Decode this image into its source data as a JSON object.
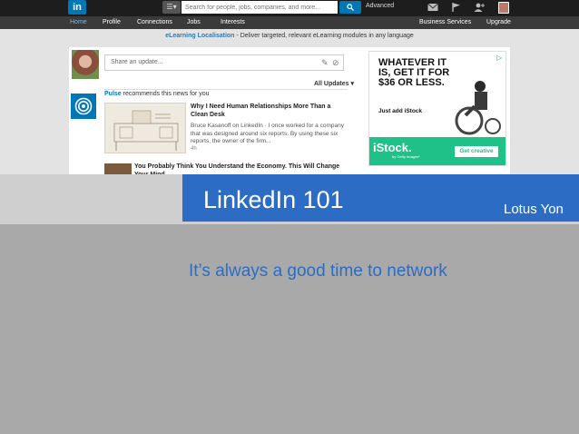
{
  "linkedin": {
    "search_placeholder": "Search for people, jobs, companies, and more...",
    "advanced_label": "Advanced",
    "nav": [
      {
        "label": "Home"
      },
      {
        "label": "Profile"
      },
      {
        "label": "Connections"
      },
      {
        "label": "Jobs"
      },
      {
        "label": "Interests"
      },
      {
        "label": "Business Services"
      },
      {
        "label": "Upgrade"
      }
    ],
    "promo": {
      "link": "eLearning Localisation",
      "text": " - Deliver targeted, relevant eLearning modules in any language"
    },
    "share_placeholder": "Share an update...",
    "all_updates": "All Updates ▾",
    "pulse": {
      "source": "Pulse",
      "text": " recommends this news for you"
    },
    "article1": {
      "title": "Why I Need Human Relationships More Than a Clean Desk",
      "body": "Bruce Kasanoff on LinkedIn  ·  I once worked for a company that was designed around six reports. By using these six reports, the owner of the firm...",
      "age": "4h"
    },
    "article2": {
      "title": "You Probably Think You Understand the Economy. This Will Change Your Mind"
    },
    "ad": {
      "headline": "WHATEVER IT IS, GET IT FOR $36 OR LESS.",
      "sub": "Just add iStock",
      "brand": "iStock.",
      "brand_sub": "by Getty Images*",
      "cta": "Get creative"
    }
  },
  "slide": {
    "title": "LinkedIn 101",
    "author": "Lotus Yon",
    "subtitle": "It’s always a good time to network"
  },
  "colors": {
    "linkedin_blue": "#0077b5",
    "slide_blue": "#2c6cc4",
    "istock_green": "#1ec288"
  }
}
